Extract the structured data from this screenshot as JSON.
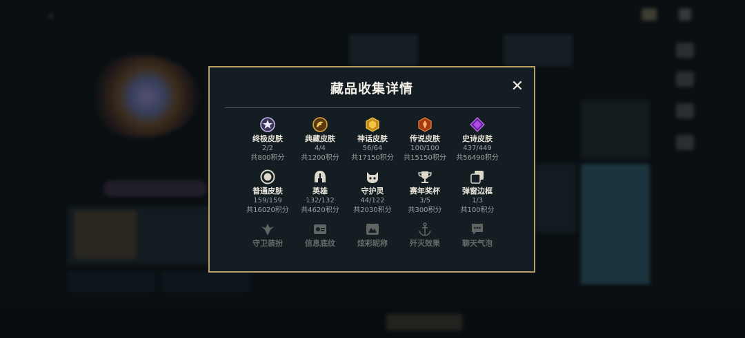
{
  "modal": {
    "title": "藏品收集详情",
    "close_label": "✕",
    "rows": [
      [
        {
          "name": "终极皮肤",
          "count": "2/2",
          "points": "共800积分",
          "icon": "ultimate-skin-icon",
          "color": "#b9a8e8"
        },
        {
          "name": "典藏皮肤",
          "count": "4/4",
          "points": "共1200积分",
          "icon": "collector-skin-icon",
          "color": "#d9a13a"
        },
        {
          "name": "神话皮肤",
          "count": "56/64",
          "points": "共17150积分",
          "icon": "mythic-skin-icon",
          "color": "#e0b33a"
        },
        {
          "name": "传说皮肤",
          "count": "100/100",
          "points": "共15150积分",
          "icon": "legendary-skin-icon",
          "color": "#e86a2c"
        },
        {
          "name": "史诗皮肤",
          "count": "437/449",
          "points": "共56490积分",
          "icon": "epic-skin-icon",
          "color": "#a54ad8"
        }
      ],
      [
        {
          "name": "普通皮肤",
          "count": "159/159",
          "points": "共16020积分",
          "icon": "standard-skin-icon",
          "color": "#d8d5cc"
        },
        {
          "name": "英雄",
          "count": "132/132",
          "points": "共4620积分",
          "icon": "champion-helmet-icon",
          "color": "#d8d5cc"
        },
        {
          "name": "守护灵",
          "count": "44/122",
          "points": "共2030积分",
          "icon": "guardian-icon",
          "color": "#d8d5cc"
        },
        {
          "name": "赛年奖杯",
          "count": "3/5",
          "points": "共300积分",
          "icon": "trophy-icon",
          "color": "#d8d5cc"
        },
        {
          "name": "弹窗边框",
          "count": "1/3",
          "points": "共100积分",
          "icon": "popup-frame-icon",
          "color": "#d8d5cc"
        }
      ],
      [
        {
          "name": "守卫装扮",
          "icon": "ward-skin-icon",
          "color": "#d8d5cc"
        },
        {
          "name": "信息底纹",
          "icon": "banner-icon",
          "color": "#d8d5cc"
        },
        {
          "name": "炫彩昵称",
          "icon": "nickname-icon",
          "color": "#d8d5cc"
        },
        {
          "name": "歼灭效果",
          "icon": "anchor-icon",
          "color": "#d8d5cc"
        },
        {
          "name": "聊天气泡",
          "icon": "chat-bubble-icon",
          "color": "#d8d5cc"
        }
      ]
    ]
  },
  "colors": {
    "frame": "#b8a06a",
    "panel": "#141d21"
  }
}
